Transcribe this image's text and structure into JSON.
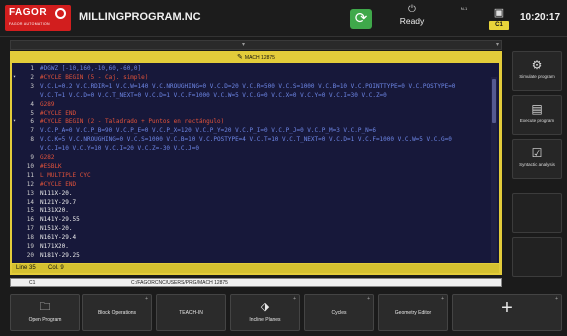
{
  "header": {
    "brand": "FAGOR",
    "brand_sub": "FAGOR AUTOMATION",
    "program_name": "MILLINGPROGRAM.NC",
    "status": "Ready",
    "channel_label": "N-1",
    "channel_badge": "C1",
    "time": "10:20:17"
  },
  "editor": {
    "title": "MACH 12875",
    "status_line": "Line 35",
    "status_col": "Col. 9",
    "lines": [
      {
        "n": "1",
        "mark": "",
        "color": "blue",
        "text": "#DGWZ [-10,160,-10,60,-60,0]"
      },
      {
        "n": "2",
        "mark": "▾",
        "color": "red",
        "text": "#CYCLE BEGIN (5 - Caj. simple)"
      },
      {
        "n": "3",
        "mark": "",
        "color": "blue",
        "text": "V.C.L=0.2 V.C.RDIR=1 V.C.W=140 V.C.NROUGHING=0 V.C.D=20 V.C.R=500 V.C.S=1000 V.C.B=10 V.C.POINTTYPE=0 V.C.POSTYPE=0"
      },
      {
        "n": "",
        "mark": "",
        "color": "blue",
        "text": "V.C.T=1 V.C.D=0 V.C.T_NEXT=0 V.C.D=1 V.C.F=1000 V.C.W=5 V.C.G=0 V.C.X=0 V.C.Y=0 V.C.I=30 V.C.Z=0"
      },
      {
        "n": "4",
        "mark": "",
        "color": "red",
        "text": "G289"
      },
      {
        "n": "5",
        "mark": "",
        "color": "red",
        "text": "#CYCLE END"
      },
      {
        "n": "6",
        "mark": "▾",
        "color": "red",
        "text": "#CYCLE BEGIN (2 - Taladrado + Puntos en rectángulo)"
      },
      {
        "n": "7",
        "mark": "",
        "color": "blue",
        "text": "V.C.P_A=0 V.C.P_B=90 V.C.P_E=0 V.C.P_X=120 V.C.P_Y=20 V.C.P_I=0 V.C.P_J=0 V.C.P_M=3 V.C.P_N=6"
      },
      {
        "n": "8",
        "mark": "",
        "color": "blue",
        "text": "V.C.K=5 V.C.NROUGHING=0 V.C.S=1000 V.C.B=10 V.C.POSTYPE=4 V.C.T=10 V.C.T_NEXT=0 V.C.D=1 V.C.F=1000 V.C.W=5 V.C.G=0"
      },
      {
        "n": "",
        "mark": "",
        "color": "blue",
        "text": "V.C.I=10 V.C.Y=10 V.C.I=20 V.C.Z=-30 V.C.J=0"
      },
      {
        "n": "9",
        "mark": "",
        "color": "red",
        "text": "G282"
      },
      {
        "n": "10",
        "mark": "",
        "color": "red",
        "text": "#ESBLK"
      },
      {
        "n": "11",
        "mark": "",
        "color": "red",
        "text": "L MULTIPLE CYC"
      },
      {
        "n": "12",
        "mark": "",
        "color": "red",
        "text": "#CYCLE END"
      },
      {
        "n": "13",
        "mark": "",
        "color": "white",
        "text": "N111X-20."
      },
      {
        "n": "14",
        "mark": "",
        "color": "white",
        "text": "N121Y-29.7"
      },
      {
        "n": "15",
        "mark": "",
        "color": "white",
        "text": "N131X20."
      },
      {
        "n": "16",
        "mark": "",
        "color": "white",
        "text": "N141Y-29.55"
      },
      {
        "n": "17",
        "mark": "",
        "color": "white",
        "text": "N151X-20."
      },
      {
        "n": "18",
        "mark": "",
        "color": "white",
        "text": "N161Y-29.4"
      },
      {
        "n": "19",
        "mark": "",
        "color": "white",
        "text": "N171X20."
      },
      {
        "n": "20",
        "mark": "",
        "color": "white",
        "text": "N181Y-29.25"
      }
    ]
  },
  "pathbar": {
    "channel": "C1",
    "path": "C:/FAGORCNC/USERS/PRG/MACH 12875"
  },
  "side_panel": [
    {
      "name": "simulate-program-button",
      "icon": "simulate-icon",
      "glyph": "⚙",
      "label": "Simulate program",
      "interactable": true
    },
    {
      "name": "execute-program-button",
      "icon": "execute-icon",
      "glyph": "▤",
      "label": "Execute program",
      "interactable": true
    },
    {
      "name": "syntactic-analysis-button",
      "icon": "syntax-check-icon",
      "glyph": "☑",
      "label": "Syntactic analysis",
      "interactable": true
    },
    {
      "name": "side-empty-button-1",
      "icon": "",
      "glyph": "",
      "label": "",
      "interactable": true
    },
    {
      "name": "side-empty-button-2",
      "icon": "",
      "glyph": "",
      "label": "",
      "interactable": true
    }
  ],
  "softkeys": [
    {
      "name": "open-program-button",
      "icon": "folder-icon",
      "glyph": "🗀",
      "label": "Open Program",
      "corner": ""
    },
    {
      "name": "block-operations-button",
      "icon": "",
      "glyph": "",
      "label": "Block Operations",
      "corner": "+"
    },
    {
      "name": "teach-in-button",
      "icon": "",
      "glyph": "",
      "label": "TEACH-IN",
      "corner": ""
    },
    {
      "name": "incline-planes-button",
      "icon": "incline-planes-icon",
      "glyph": "⬗",
      "label": "Incline Planes",
      "corner": "+"
    },
    {
      "name": "cycles-button",
      "icon": "",
      "glyph": "",
      "label": "Cycles",
      "corner": "+"
    },
    {
      "name": "geometry-editor-button",
      "icon": "",
      "glyph": "",
      "label": "Geometry Editor",
      "corner": "+"
    },
    {
      "name": "plus-button",
      "icon": "plus-icon",
      "glyph": "+",
      "label": "",
      "corner": "+"
    }
  ],
  "colors": {
    "editor_border": "#e3cc3a",
    "code_background": "#17183a",
    "code_blue": "#6d86e6",
    "code_red": "#e0523a",
    "brand_red": "#d21e1e",
    "cycle_green": "#3fa84a",
    "channel_badge": "#e8d43a"
  }
}
